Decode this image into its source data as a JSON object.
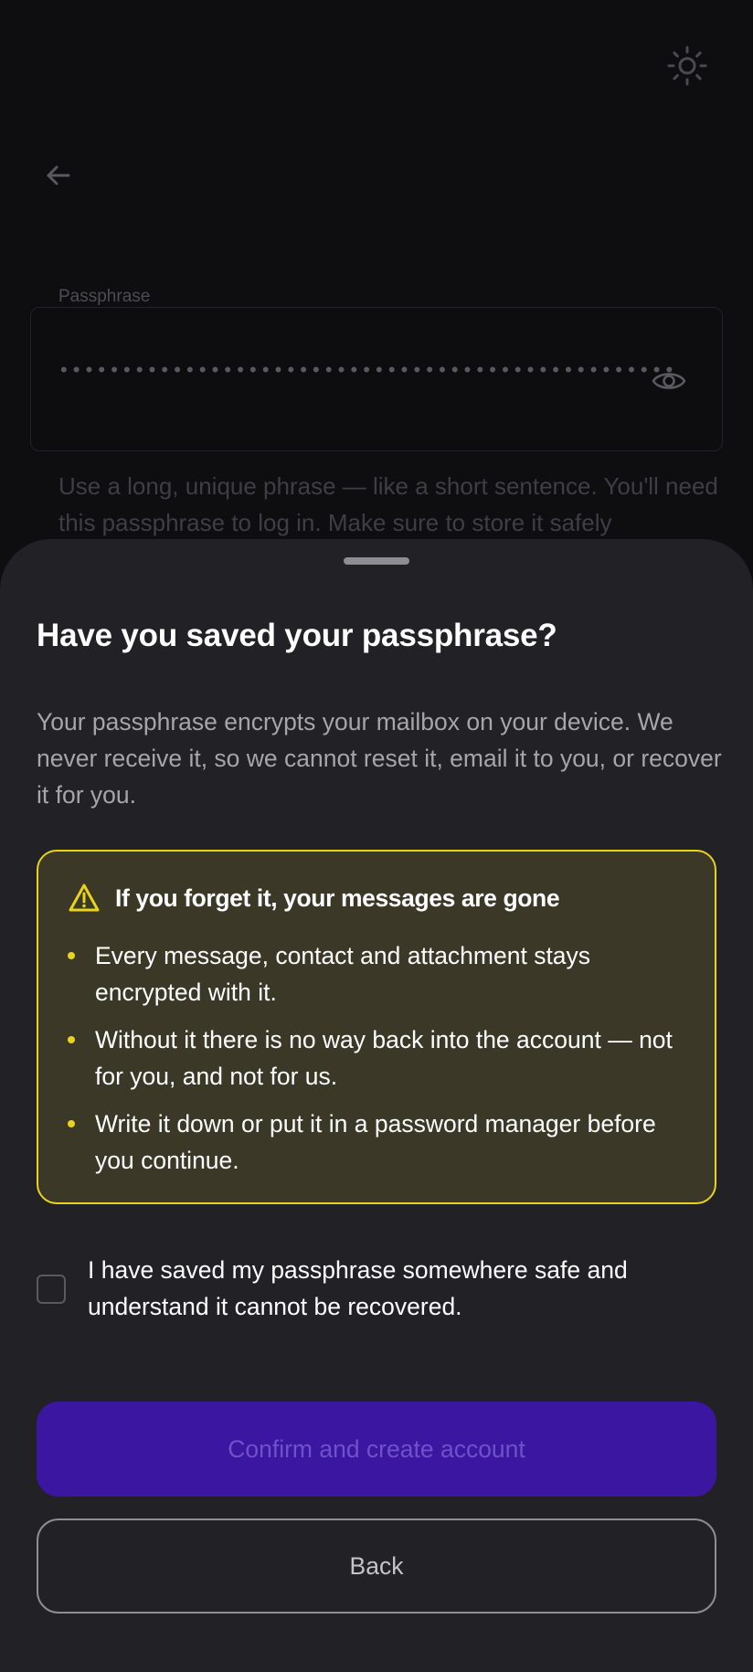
{
  "background": {
    "theme_icon": "sun-icon",
    "back_icon": "arrow-left-icon",
    "passphrase": {
      "label": "Passphrase",
      "masked_value": "••••••••••••••••••••••••••••••••••••••••••••••••••••••••••••••••",
      "visibility_icon": "eye-icon",
      "hint": "Use a long, unique phrase — like a short sentence. You'll need this passphrase to log in. Make sure to store it safely"
    }
  },
  "sheet": {
    "title": "Have you saved your passphrase?",
    "body": "Your passphrase encrypts your mailbox on your device. We never receive it, so we cannot reset it, email it to you, or recover it for you.",
    "warning": {
      "icon": "warning-triangle-icon",
      "title": "If you forget it, your messages are gone",
      "items": [
        "Every message, contact and attachment stays encrypted with it.",
        "Without it there is no way back into the account — not for you, and not for us.",
        "Write it down or put it in a password manager before you continue."
      ]
    },
    "confirm": {
      "checked": false,
      "label": "I have saved my passphrase somewhere safe and understand it cannot be recovered."
    },
    "primary_button": "Confirm and create account",
    "secondary_button": "Back"
  },
  "colors": {
    "accent": "#3a16a1",
    "warning": "#e8d31d",
    "sheet_background": "#222126"
  }
}
